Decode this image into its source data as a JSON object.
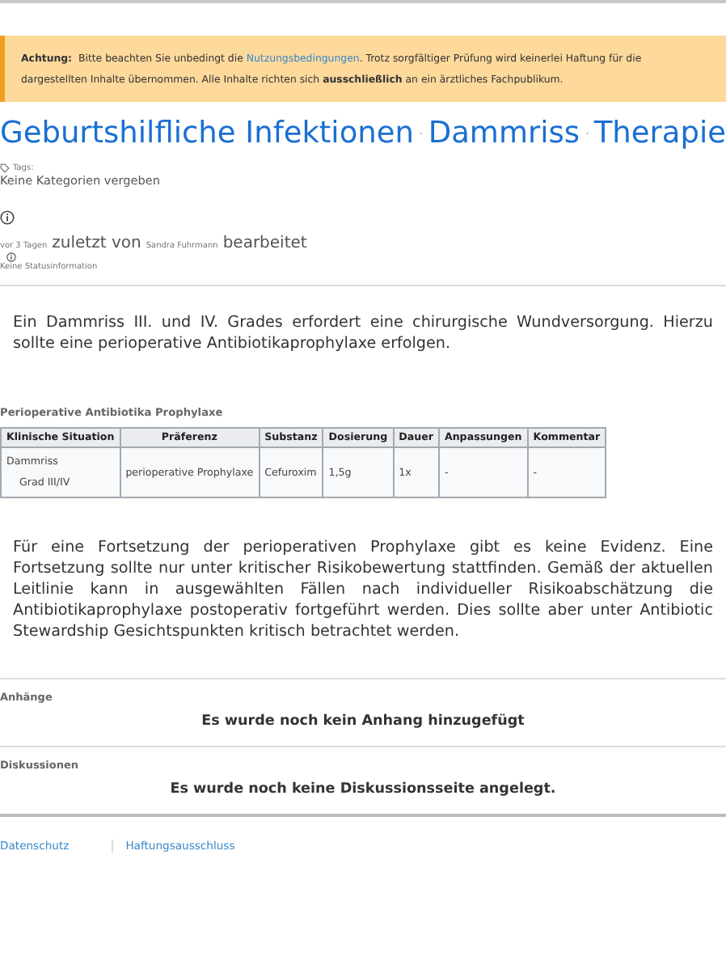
{
  "notice": {
    "label": "Achtung:",
    "text_before": "Bitte beachten Sie unbedingt die",
    "link": "Nutzungsbedingungen",
    "text_after": ". Trotz sorgfältiger Prüfung wird keinerlei Haftung für die dargestellten Inhalte übernommen. Alle Inhalte richten sich **ausschließlich** an ein ärztliches Fachpublikum."
  },
  "breadcrumbs": [
    "Geburtshilfliche Infektionen",
    "Dammriss",
    "Therapie"
  ],
  "tags": {
    "label": "Tags:",
    "value": "Keine Kategorien vergeben"
  },
  "edit_info": {
    "time": "vor 3 Tagen",
    "middle": "zuletzt von",
    "author": "Sandra Fuhrmann",
    "end": "bearbeitet"
  },
  "status": "Keine Statusinformation",
  "intro": "Ein Dammriss III. und IV. Grades erfordert eine chirurgische Wundversorgung. Hierzu sollte eine perioperative Antibiotikaprophylaxe erfolgen.",
  "table": {
    "title": "Perioperative Antibiotika Prophylaxe",
    "columns": [
      "Klinische Situation",
      "Präferenz",
      "Substanz",
      "Dosierung",
      "Dauer",
      "Anpassungen",
      "Kommentar"
    ],
    "rows": [
      [
        [
          "Dammriss",
          "Grad III/IV"
        ],
        [
          "perioperative Prophylaxe"
        ],
        [
          "Cefuroxim"
        ],
        [
          "1,5g"
        ],
        [
          "1x"
        ],
        [
          "-"
        ],
        [
          "-"
        ]
      ]
    ]
  },
  "body": "Für eine Fortsetzung der perioperativen Prophylaxe gibt es keine Evidenz. Eine Fortsetzung sollte nur unter kritischer Risikobewertung stattfinden. Gemäß der aktuellen Leitlinie kann in ausgewählten Fällen nach individueller Risikoabschätzung die Antibiotikaprophylaxe postoperativ fortgeführt werden. Dies sollte aber unter Antibiotic Stewardship Gesichtspunkten kritisch betrachtet werden.",
  "sections": [
    {
      "title": "Anhänge",
      "message": "Es wurde noch kein Anhang hinzugefügt"
    },
    {
      "title": "Diskussionen",
      "message": "Es wurde noch keine Diskussionsseite angelegt."
    }
  ],
  "footer_links": [
    "Datenschutz",
    "Haftungsausschluss"
  ]
}
